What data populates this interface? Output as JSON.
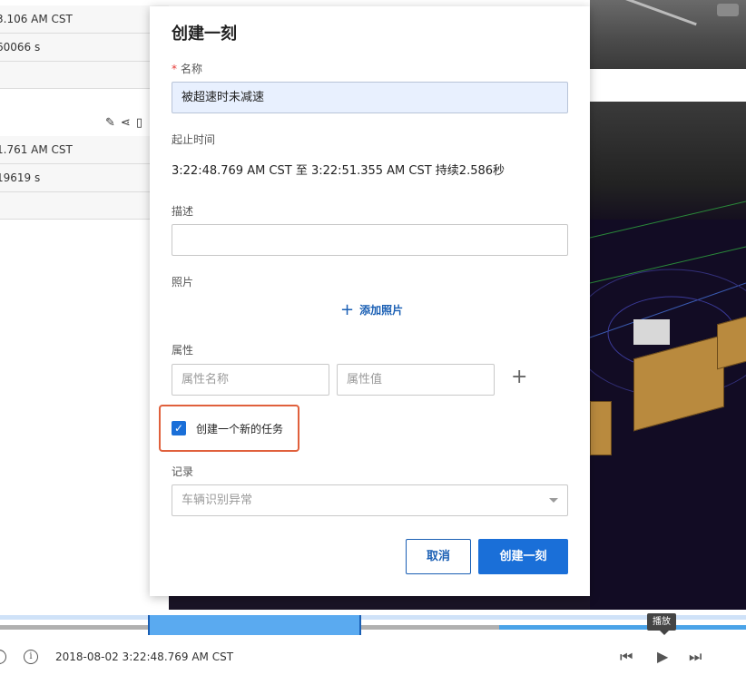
{
  "left_panel": {
    "rows": [
      "3.106 AM CST",
      "60066 s",
      "1.761 AM CST",
      "19619 s"
    ]
  },
  "dialog": {
    "title": "创建一刻",
    "name_label": "名称",
    "required_mark": "*",
    "name_value": "被超速时未减速",
    "time_label": "起止时间",
    "time_range": "3:22:48.769 AM CST 至 3:22:51.355 AM CST 持续2.586秒",
    "description_label": "描述",
    "description_value": "",
    "photos_label": "照片",
    "add_photo_label": "添加照片",
    "attributes_label": "属性",
    "attr_name_placeholder": "属性名称",
    "attr_value_placeholder": "属性值",
    "create_task_label": "创建一个新的任务",
    "create_task_checked": true,
    "record_label": "记录",
    "record_placeholder": "车辆识别异常",
    "cancel_label": "取消",
    "create_label": "创建一刻"
  },
  "timeline": {
    "timestamp": "2018-08-02 3:22:48.769 AM CST",
    "play_tooltip": "播放"
  },
  "colors": {
    "primary": "#1a6fd8",
    "highlight_border": "#e0603c",
    "required": "#e53935"
  }
}
